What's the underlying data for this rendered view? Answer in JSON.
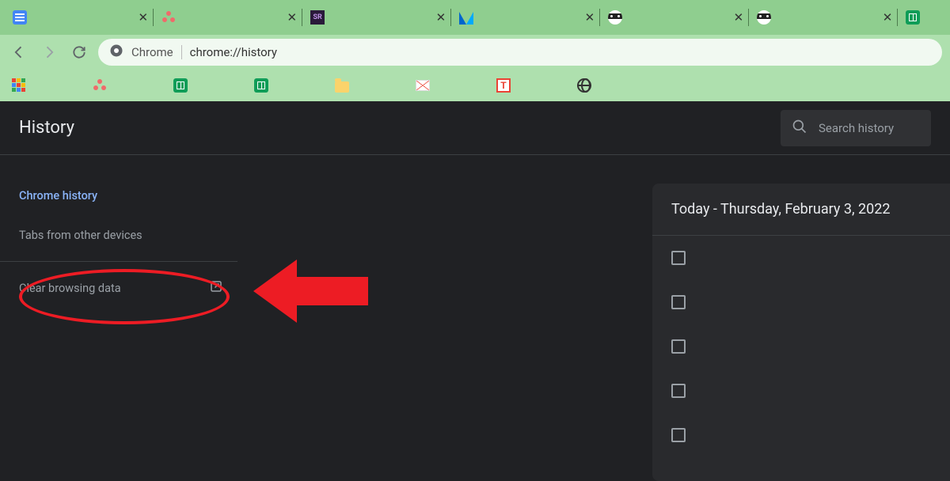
{
  "tabs": [
    {
      "kind": "docs"
    },
    {
      "kind": "asana"
    },
    {
      "kind": "sr",
      "badge": "SR"
    },
    {
      "kind": "blue"
    },
    {
      "kind": "ninja"
    },
    {
      "kind": "ninja"
    },
    {
      "kind": "sheets"
    }
  ],
  "omnibox": {
    "site_label": "Chrome",
    "url": "chrome://history"
  },
  "bookmarks": [
    {
      "kind": "grid"
    },
    {
      "kind": "asana"
    },
    {
      "kind": "sheets"
    },
    {
      "kind": "sheets"
    },
    {
      "kind": "folder"
    },
    {
      "kind": "gmail"
    },
    {
      "kind": "t"
    },
    {
      "kind": "globe"
    }
  ],
  "history": {
    "title": "History",
    "search_placeholder": "Search history",
    "sidebar": {
      "chrome_history": "Chrome history",
      "tabs_other": "Tabs from other devices",
      "clear_data": "Clear browsing data"
    },
    "card": {
      "date_header": "Today - Thursday, February 3, 2022",
      "row_count": 5
    }
  }
}
